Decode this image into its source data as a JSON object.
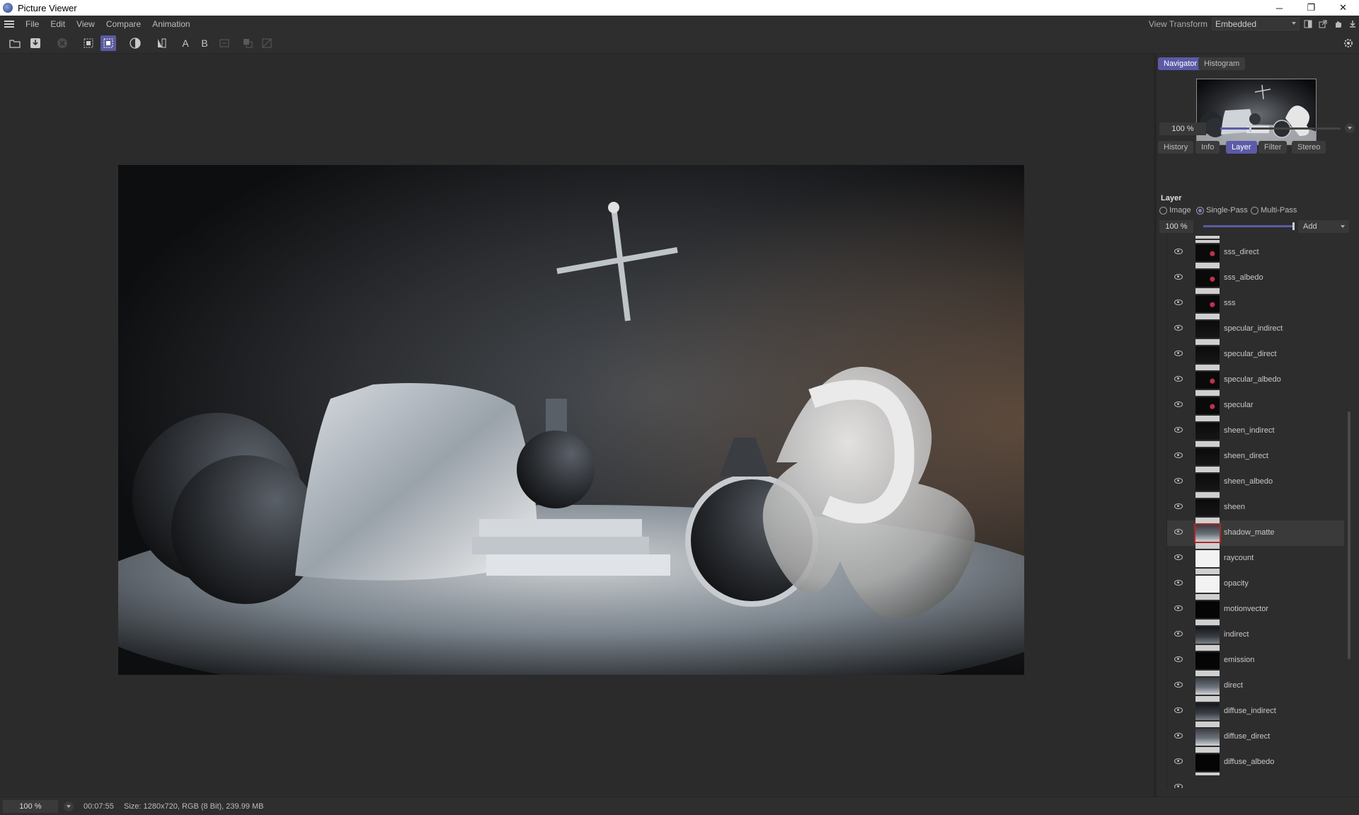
{
  "window": {
    "title": "Picture Viewer",
    "controls": [
      "─",
      "❐",
      "✕"
    ]
  },
  "menu": {
    "items": [
      "File",
      "Edit",
      "View",
      "Compare",
      "Animation"
    ],
    "view_transform_label": "View Transform",
    "view_transform_value": "Embedded"
  },
  "toolbar": {
    "compare_a": "A",
    "compare_b": "B"
  },
  "navigator": {
    "tabs": [
      "Navigator",
      "Histogram"
    ],
    "active_tab": "Navigator",
    "zoom": "100 %",
    "zoom_level": 0.25
  },
  "panel_tabs": {
    "tabs": [
      "History",
      "Info",
      "Layer",
      "Filter",
      "Stereo"
    ],
    "active_tab": "Layer"
  },
  "layer": {
    "title": "Layer",
    "modes": [
      "Image",
      "Single-Pass",
      "Multi-Pass"
    ],
    "selected_mode": "Single-Pass",
    "opacity": "100 %",
    "opacity_level": 1.0,
    "blend_mode": "Add",
    "items": [
      {
        "name": "sss_direct",
        "thumb": "dark-red"
      },
      {
        "name": "sss_albedo",
        "thumb": "dark-red"
      },
      {
        "name": "sss",
        "thumb": "dark-red"
      },
      {
        "name": "specular_indirect",
        "thumb": "dark"
      },
      {
        "name": "specular_direct",
        "thumb": "dark"
      },
      {
        "name": "specular_albedo",
        "thumb": "dark-red"
      },
      {
        "name": "specular",
        "thumb": "dark-red"
      },
      {
        "name": "sheen_indirect",
        "thumb": "dark"
      },
      {
        "name": "sheen_direct",
        "thumb": "dark"
      },
      {
        "name": "sheen_albedo",
        "thumb": "dark"
      },
      {
        "name": "sheen",
        "thumb": "dark"
      },
      {
        "name": "shadow_matte",
        "thumb": "scene",
        "selected": true
      },
      {
        "name": "raycount",
        "thumb": "white"
      },
      {
        "name": "opacity",
        "thumb": "white"
      },
      {
        "name": "motionvector",
        "thumb": "black"
      },
      {
        "name": "indirect",
        "thumb": "scene-dim"
      },
      {
        "name": "emission",
        "thumb": "black"
      },
      {
        "name": "direct",
        "thumb": "scene"
      },
      {
        "name": "diffuse_indirect",
        "thumb": "scene-dim"
      },
      {
        "name": "diffuse_direct",
        "thumb": "scene"
      },
      {
        "name": "diffuse_albedo",
        "thumb": "black"
      }
    ]
  },
  "status": {
    "zoom": "100 %",
    "time": "00:07:55",
    "size_info": "Size: 1280x720, RGB (8 Bit), 239.99 MB"
  },
  "colors": {
    "accent": "#5b5ba8",
    "background": "#2b2b2b",
    "selection_outline": "#b02828"
  }
}
